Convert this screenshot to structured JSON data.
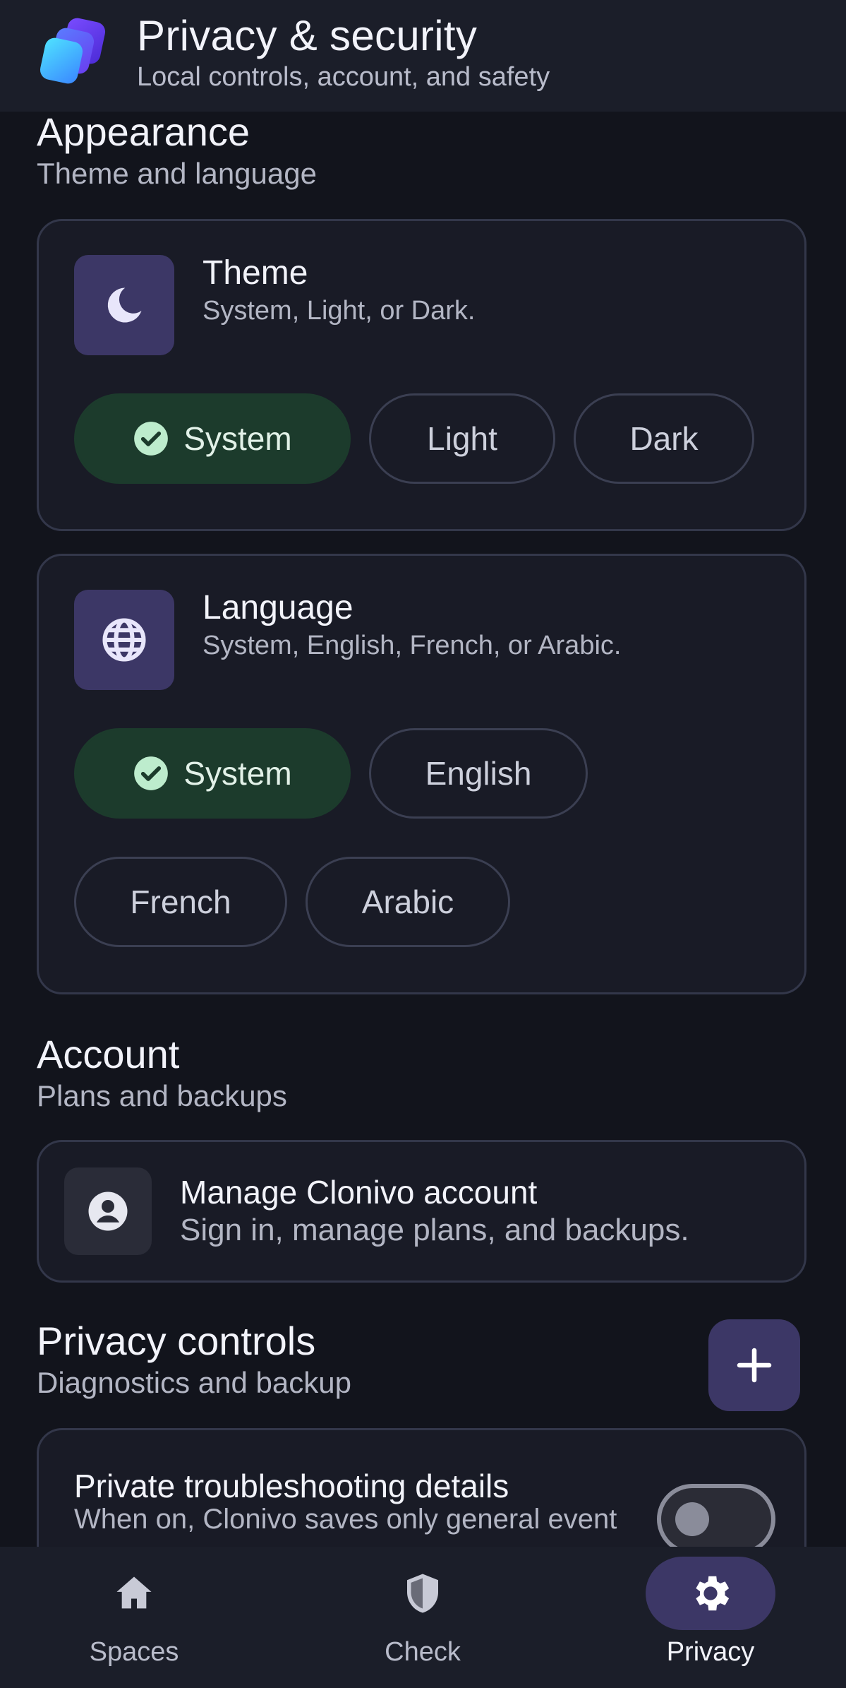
{
  "header": {
    "title": "Privacy & security",
    "subtitle": "Local controls, account, and safety"
  },
  "appearance": {
    "title": "Appearance",
    "subtitle": "Theme and language",
    "theme": {
      "title": "Theme",
      "description": "System, Light, or Dark.",
      "icon": "moon-icon",
      "options": [
        "System",
        "Light",
        "Dark"
      ],
      "selected": "System"
    },
    "language": {
      "title": "Language",
      "description": "System, English, French, or Arabic.",
      "icon": "globe-icon",
      "options": [
        "System",
        "English",
        "French",
        "Arabic"
      ],
      "selected": "System"
    }
  },
  "account": {
    "title": "Account",
    "subtitle": "Plans and backups",
    "manage_title": "Manage Clonivo account",
    "manage_desc": "Sign in, manage plans, and backups.",
    "icon": "account-circle-icon"
  },
  "privacy": {
    "title": "Privacy controls",
    "subtitle": "Diagnostics and backup",
    "add_icon": "plus-icon",
    "troubleshooting_title": "Private troubleshooting details",
    "troubleshooting_desc": "When on, Clonivo saves only general event",
    "toggle_on": false
  },
  "nav": {
    "items": [
      {
        "label": "Spaces",
        "icon": "home-icon",
        "active": false
      },
      {
        "label": "Check",
        "icon": "shield-icon",
        "active": false
      },
      {
        "label": "Privacy",
        "icon": "gear-icon",
        "active": true
      }
    ]
  },
  "colors": {
    "background": "#12141c",
    "surface": "#191b26",
    "accent": "#3c3766",
    "selected_chip": "#1c3b2c",
    "check": "#bdeccd"
  }
}
